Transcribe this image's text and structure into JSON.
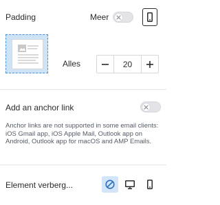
{
  "padding": {
    "title": "Padding",
    "more_label": "Meer",
    "all_label": "Alles",
    "value": "20",
    "more_toggle_on": false,
    "device_icon": "mobile-icon"
  },
  "anchor": {
    "title": "Add an anchor link",
    "toggle_on": false,
    "note": "Anchor links are not supported in some email clients: iOS Gmail app, iOS Apple Mail, Outlook app on Android, Outlook app for macOS and AMP Emails."
  },
  "hide": {
    "title": "Element verberg...",
    "options": [
      "hide-none-icon",
      "desktop-icon",
      "mobile-icon"
    ],
    "selected": "hide-none-icon"
  },
  "colors": {
    "accent": "#4a90d9",
    "accent_light": "#d3e5f9",
    "text": "#2b2b2b",
    "muted": "#555b66"
  }
}
